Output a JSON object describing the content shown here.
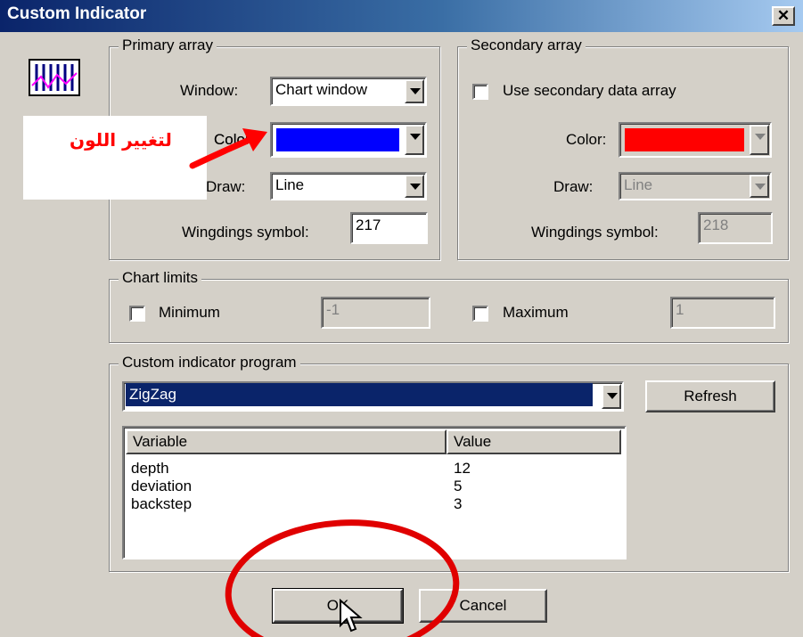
{
  "window": {
    "title": "Custom Indicator",
    "close_glyph": "✕"
  },
  "annotation": {
    "arabic_note": "لتغيير اللون",
    "arrow_color": "#ff0000",
    "circle_color": "#e00000"
  },
  "primary": {
    "legend": "Primary array",
    "window_label": "Window:",
    "window_value": "Chart window",
    "color_label": "Color:",
    "color_value": "#0000ff",
    "draw_label": "Draw:",
    "draw_value": "Line",
    "wingdings_label": "Wingdings symbol:",
    "wingdings_value": "217"
  },
  "secondary": {
    "legend": "Secondary array",
    "use_label": "Use secondary data array",
    "use_checked": false,
    "color_label": "Color:",
    "color_value": "#ff0000",
    "draw_label": "Draw:",
    "draw_value": "Line",
    "wingdings_label": "Wingdings symbol:",
    "wingdings_value": "218"
  },
  "limits": {
    "legend": "Chart limits",
    "minimum_label": "Minimum",
    "minimum_value": "-1",
    "maximum_label": "Maximum",
    "maximum_value": "1"
  },
  "program": {
    "legend": "Custom indicator program",
    "selected": "ZigZag",
    "refresh_label": "Refresh",
    "columns": [
      "Variable",
      "Value"
    ],
    "rows": [
      {
        "variable": "depth",
        "value": "12"
      },
      {
        "variable": "deviation",
        "value": "5"
      },
      {
        "variable": "backstep",
        "value": "3"
      }
    ]
  },
  "buttons": {
    "ok": "OK",
    "cancel": "Cancel"
  },
  "icons": {
    "indicator": "indicator-chart-icon",
    "cursor": "mouse-pointer-icon"
  }
}
